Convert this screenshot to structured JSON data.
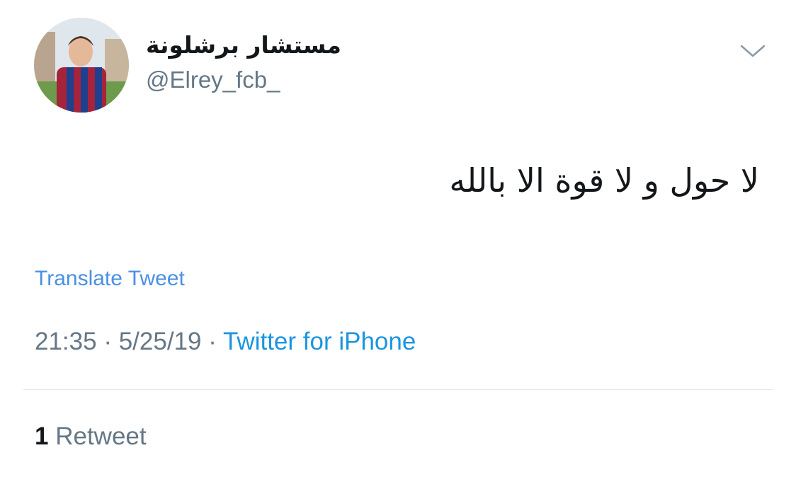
{
  "user": {
    "display_name": "مستشار برشلونة",
    "handle": "@Elrey_fcb_",
    "avatar_icon": "profile-photo"
  },
  "menu": {
    "caret_icon": "chevron-down-icon"
  },
  "tweet": {
    "text": "لا حول و لا قوة الا بالله",
    "translate_label": "Translate Tweet",
    "time": "21:35",
    "date": "5/25/19",
    "separator": "·",
    "source": "Twitter for iPhone"
  },
  "stats": {
    "retweet_count": "1",
    "retweet_label": "Retweet"
  },
  "colors": {
    "link_blue": "#1b95e0",
    "translate_blue": "#4a90e2",
    "muted_gray": "#657786",
    "text_dark": "#14171a",
    "divider": "#e1e8ed"
  }
}
